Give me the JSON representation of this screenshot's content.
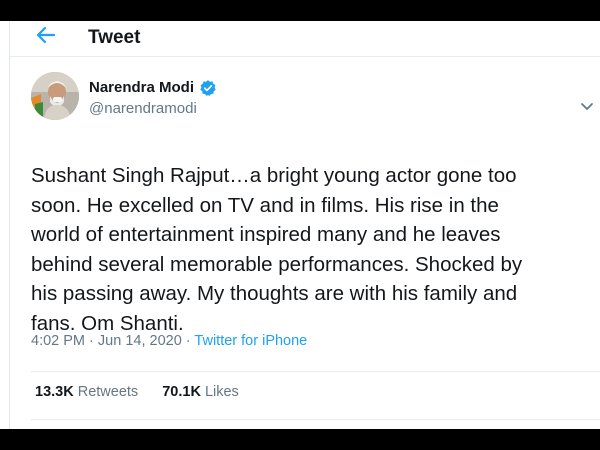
{
  "header": {
    "title": "Tweet"
  },
  "author": {
    "name": "Narendra Modi",
    "handle": "@narendramodi"
  },
  "tweet": {
    "text": "Sushant Singh Rajput…a bright young actor gone too\nsoon. He excelled on TV and in films. His rise in the\nworld of entertainment inspired many and he leaves\nbehind several memorable performances. Shocked by\nhis passing away. My thoughts are with his family and\nfans. Om Shanti.",
    "time": "4:02 PM",
    "date": "Jun 14, 2020",
    "separator": "·",
    "source": "Twitter for iPhone"
  },
  "stats": {
    "retweets_count": "13.3K",
    "retweets_label": "Retweets",
    "likes_count": "70.1K",
    "likes_label": "Likes"
  },
  "colors": {
    "accent": "#1da1f2",
    "text": "#14171a",
    "secondary": "#657786"
  },
  "icons": {
    "back": "arrow-left-icon",
    "verified": "verified-badge-icon",
    "more": "chevron-down-icon"
  }
}
